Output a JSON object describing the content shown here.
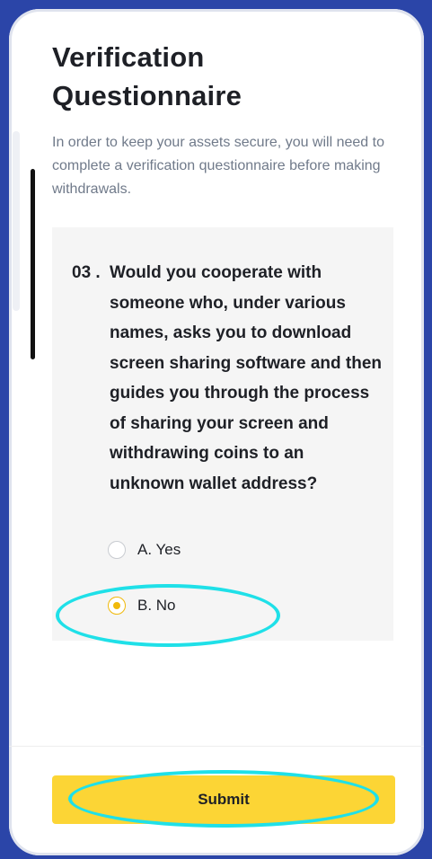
{
  "page": {
    "title": "Verification Questionnaire",
    "description": "In order to keep your assets secure, you will need to complete a verification questionnaire before making withdrawals."
  },
  "question": {
    "number": "03 .",
    "text": "Would you cooperate with someone who, under various names, asks you to download screen sharing software and then guides you through the process of sharing your screen and withdrawing coins to an unknown wallet address?",
    "options": [
      {
        "label": "A. Yes",
        "selected": false
      },
      {
        "label": "B. No",
        "selected": true
      }
    ]
  },
  "submit": {
    "label": "Submit"
  },
  "colors": {
    "background": "#2b45a8",
    "accent": "#fcd535",
    "radio_selected": "#f0b90b",
    "highlight": "#1fe0e8"
  }
}
